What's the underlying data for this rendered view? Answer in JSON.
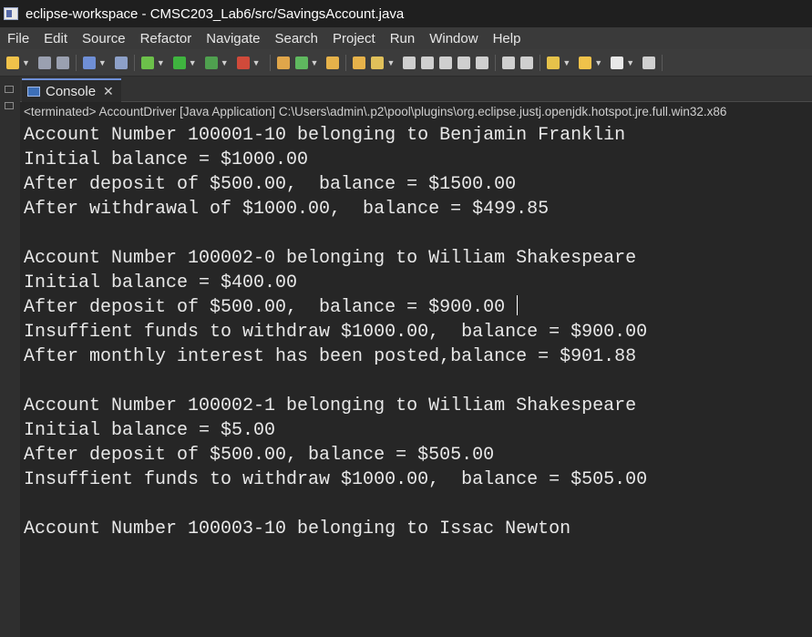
{
  "window": {
    "title": "eclipse-workspace - CMSC203_Lab6/src/SavingsAccount.java"
  },
  "menu": [
    "File",
    "Edit",
    "Source",
    "Refactor",
    "Navigate",
    "Search",
    "Project",
    "Run",
    "Window",
    "Help"
  ],
  "toolbar_icons": [
    {
      "name": "new-icon",
      "color": "#f0c24a"
    },
    {
      "name": "save-icon",
      "color": "#9aa0b0"
    },
    {
      "name": "save-all-icon",
      "color": "#9aa0b0"
    },
    {
      "name": "print-icon",
      "color": "#6f8fd6"
    },
    {
      "name": "skip-breakpoints-icon",
      "color": "#8da0c8"
    },
    {
      "name": "debug-icon",
      "color": "#6cc04a"
    },
    {
      "name": "run-icon",
      "color": "#3fb43f"
    },
    {
      "name": "coverage-icon",
      "color": "#4fa04f"
    },
    {
      "name": "external-tools-icon",
      "color": "#d04a3a"
    },
    {
      "name": "new-java-project-icon",
      "color": "#e0a64a"
    },
    {
      "name": "new-class-icon",
      "color": "#5fb85f"
    },
    {
      "name": "open-type-icon",
      "color": "#e6b24a"
    },
    {
      "name": "open-task-icon",
      "color": "#e6b24a"
    },
    {
      "name": "search-icon",
      "color": "#e0c05a"
    },
    {
      "name": "annotation-icon",
      "color": "#cfcfcf"
    },
    {
      "name": "toggle-mark-icon",
      "color": "#cfcfcf"
    },
    {
      "name": "block-select-icon",
      "color": "#cfcfcf"
    },
    {
      "name": "word-wrap-icon",
      "color": "#cfcfcf"
    },
    {
      "name": "whitespace-icon",
      "color": "#cfcfcf"
    },
    {
      "name": "next-annotation-icon",
      "color": "#cfcfcf"
    },
    {
      "name": "prev-annotation-icon",
      "color": "#cfcfcf"
    },
    {
      "name": "last-edit-icon",
      "color": "#e6c24a"
    },
    {
      "name": "back-icon",
      "color": "#f0c24a"
    },
    {
      "name": "forward-icon",
      "color": "#e8e8e8"
    },
    {
      "name": "pin-editor-icon",
      "color": "#cfcfcf"
    }
  ],
  "console_tab": {
    "label": "Console",
    "close": "✕"
  },
  "status": {
    "text": "<terminated> AccountDriver [Java Application] C:\\Users\\admin\\.p2\\pool\\plugins\\org.eclipse.justj.openjdk.hotspot.jre.full.win32.x86"
  },
  "output": [
    "Account Number 100001-10 belonging to Benjamin Franklin",
    "Initial balance = $1000.00",
    "After deposit of $500.00,  balance = $1500.00",
    "After withdrawal of $1000.00,  balance = $499.85",
    "",
    "Account Number 100002-0 belonging to William Shakespeare",
    "Initial balance = $400.00",
    "After deposit of $500.00,  balance = $900.00",
    "Insuffient funds to withdraw $1000.00,  balance = $900.00",
    "After monthly interest has been posted,balance = $901.88",
    "",
    "Account Number 100002-1 belonging to William Shakespeare",
    "Initial balance = $5.00",
    "After deposit of $500.00, balance = $505.00",
    "Insuffient funds to withdraw $1000.00,  balance = $505.00",
    "",
    "Account Number 100003-10 belonging to Issac Newton"
  ]
}
